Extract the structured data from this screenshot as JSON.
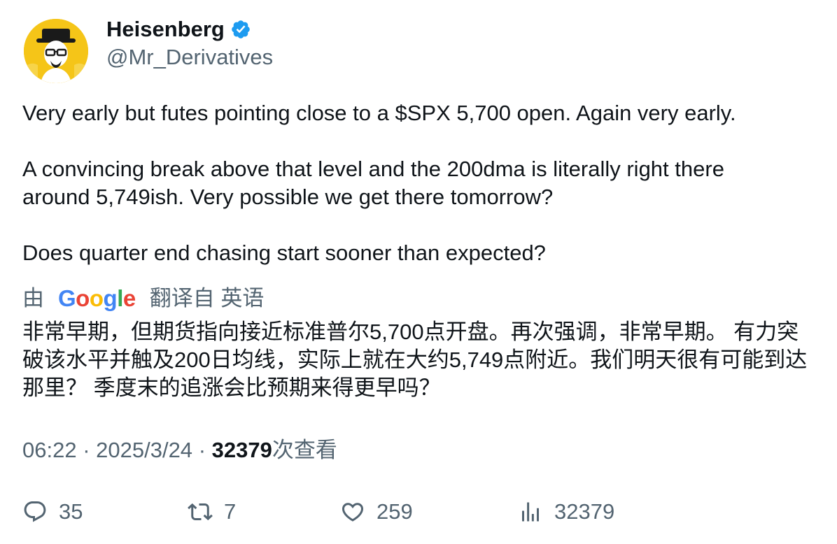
{
  "author": {
    "name": "Heisenberg",
    "handle": "@Mr_Derivatives",
    "verified_icon": "verified-badge-icon",
    "badge_color": "#1d9bf0"
  },
  "tweet": {
    "paragraphs": [
      "Very early but futes pointing close to a $SPX 5,700 open. Again very early.",
      "A convincing break above that level and the 200dma is literally right there around 5,749ish. Very possible we get there tomorrow?",
      "Does quarter end chasing start sooner than expected?"
    ]
  },
  "translation": {
    "prefix": "由",
    "provider": "Google",
    "suffix": "翻译自 英语",
    "text": "非常早期，但期货指向接近标准普尔5,700点开盘。再次强调，非常早期。 有力突破该水平并触及200日均线，实际上就在大约5,749点附近。我们明天很有可能到达那里？ 季度末的追涨会比预期来得更早吗？"
  },
  "meta": {
    "time": "06:22",
    "date": "2025/3/24",
    "views": "32379",
    "views_label": "次查看"
  },
  "actions": {
    "replies": "35",
    "retweets": "7",
    "likes": "259",
    "views": "32379"
  },
  "colors": {
    "text": "#0f1419",
    "secondary": "#536471",
    "avatar_bg": "#f5c518"
  }
}
